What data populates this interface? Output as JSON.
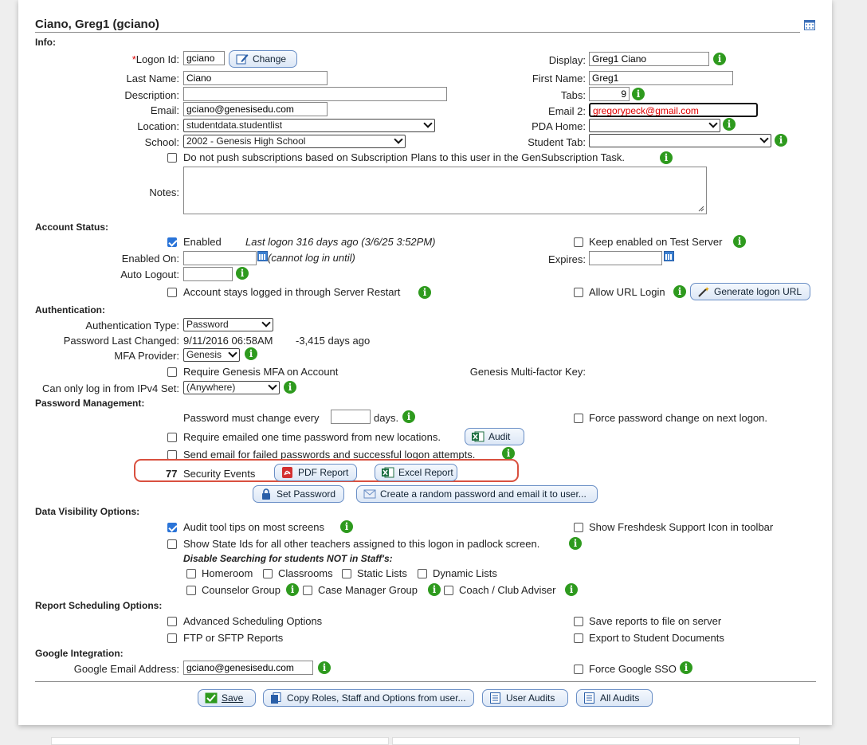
{
  "header": {
    "title": "Ciano, Greg1 (gciano)"
  },
  "sections": {
    "info": "Info:",
    "account_status": "Account Status:",
    "authentication": "Authentication:",
    "password_management": "Password Management:",
    "data_visibility": "Data Visibility Options:",
    "report_scheduling": "Report Scheduling Options:",
    "google": "Google Integration:"
  },
  "info": {
    "logon_required": "*",
    "logon_label": "Logon Id:",
    "logon_value": "gciano",
    "change_label": "Change",
    "last_name_label": "Last Name:",
    "last_name_value": "Ciano",
    "description_label": "Description:",
    "description_value": "",
    "email_label": "Email:",
    "email_value": "gciano@genesisedu.com",
    "location_label": "Location:",
    "location_value": "studentdata.studentlist",
    "school_label": "School:",
    "school_value": "2002 - Genesis High School",
    "display_label": "Display:",
    "display_value": "Greg1 Ciano",
    "first_name_label": "First Name:",
    "first_name_value": "Greg1",
    "tabs_label": "Tabs:",
    "tabs_value": "9",
    "email2_label": "Email 2:",
    "email2_value": "gregorypeck@gmail.com",
    "pda_home_label": "PDA Home:",
    "pda_home_value": "",
    "student_tab_label": "Student Tab:",
    "student_tab_value": "",
    "no_push_label": "Do not push subscriptions based on Subscription Plans to this user in the GenSubscription Task.",
    "notes_label": "Notes:"
  },
  "account": {
    "enabled_label": "Enabled",
    "last_logon": "Last logon 316 days ago (3/6/25 3:52PM)",
    "keep_enabled_label": "Keep enabled on Test Server",
    "enabled_on_label": "Enabled On:",
    "cannot_login": "(cannot log in until)",
    "expires_label": "Expires:",
    "auto_logout_label": "Auto Logout:",
    "stays_logged_label": "Account stays logged in through Server Restart",
    "allow_url_label": "Allow URL Login",
    "generate_url_label": "Generate logon URL"
  },
  "auth": {
    "type_label": "Authentication Type:",
    "type_value": "Password",
    "pw_changed_label": "Password Last Changed:",
    "pw_changed_value": "9/11/2016 06:58AM",
    "pw_changed_ago": "-3,415 days ago",
    "mfa_label": "MFA Provider:",
    "mfa_value": "Genesis",
    "require_mfa_label": "Require Genesis MFA on Account",
    "mfa_key_label": "Genesis Multi-factor Key:",
    "ipv4_label": "Can only log in from IPv4 Set:",
    "ipv4_value": "(Anywhere)"
  },
  "pwmgmt": {
    "must_change_label": "Password must change every",
    "days_label": "days.",
    "force_change_label": "Force password change on next logon.",
    "require_otp_label": "Require emailed one time password from new locations.",
    "audit_label": "Audit",
    "send_email_label": "Send email for failed passwords and successful logon attempts.",
    "events_count": "77",
    "events_label": "Security Events",
    "pdf_label": "PDF Report",
    "excel_label": "Excel Report",
    "set_password_label": "Set Password",
    "random_pw_label": "Create a random password and email it to user..."
  },
  "visibility": {
    "audit_tips_label": "Audit tool tips on most screens",
    "freshdesk_label": "Show Freshdesk Support Icon in toolbar",
    "state_ids_label": "Show State Ids for all other teachers assigned to this logon in padlock screen.",
    "disable_heading": "Disable Searching for students NOT in Staff's:",
    "homeroom": "Homeroom",
    "classrooms": "Classrooms",
    "static_lists": "Static Lists",
    "dynamic_lists": "Dynamic Lists",
    "counselor": "Counselor Group",
    "case_manager": "Case Manager Group",
    "coach": "Coach / Club Adviser"
  },
  "reporting": {
    "advanced": "Advanced Scheduling Options",
    "save_to_file": "Save reports to file on server",
    "ftp": "FTP or SFTP Reports",
    "export_docs": "Export to Student Documents"
  },
  "google": {
    "email_label": "Google Email Address:",
    "email_value": "gciano@genesisedu.com",
    "force_sso": "Force Google SSO"
  },
  "footer": {
    "save": "Save",
    "copy_roles": "Copy Roles, Staff and Options from user...",
    "user_audits": "User Audits",
    "all_audits": "All Audits"
  },
  "colors": {
    "info_icon": "#2e9a1e",
    "checkbox_on": "#2a74d8",
    "highlight": "#d9503f",
    "button_border": "#6a8fc6",
    "email2_text": "#e00000"
  }
}
